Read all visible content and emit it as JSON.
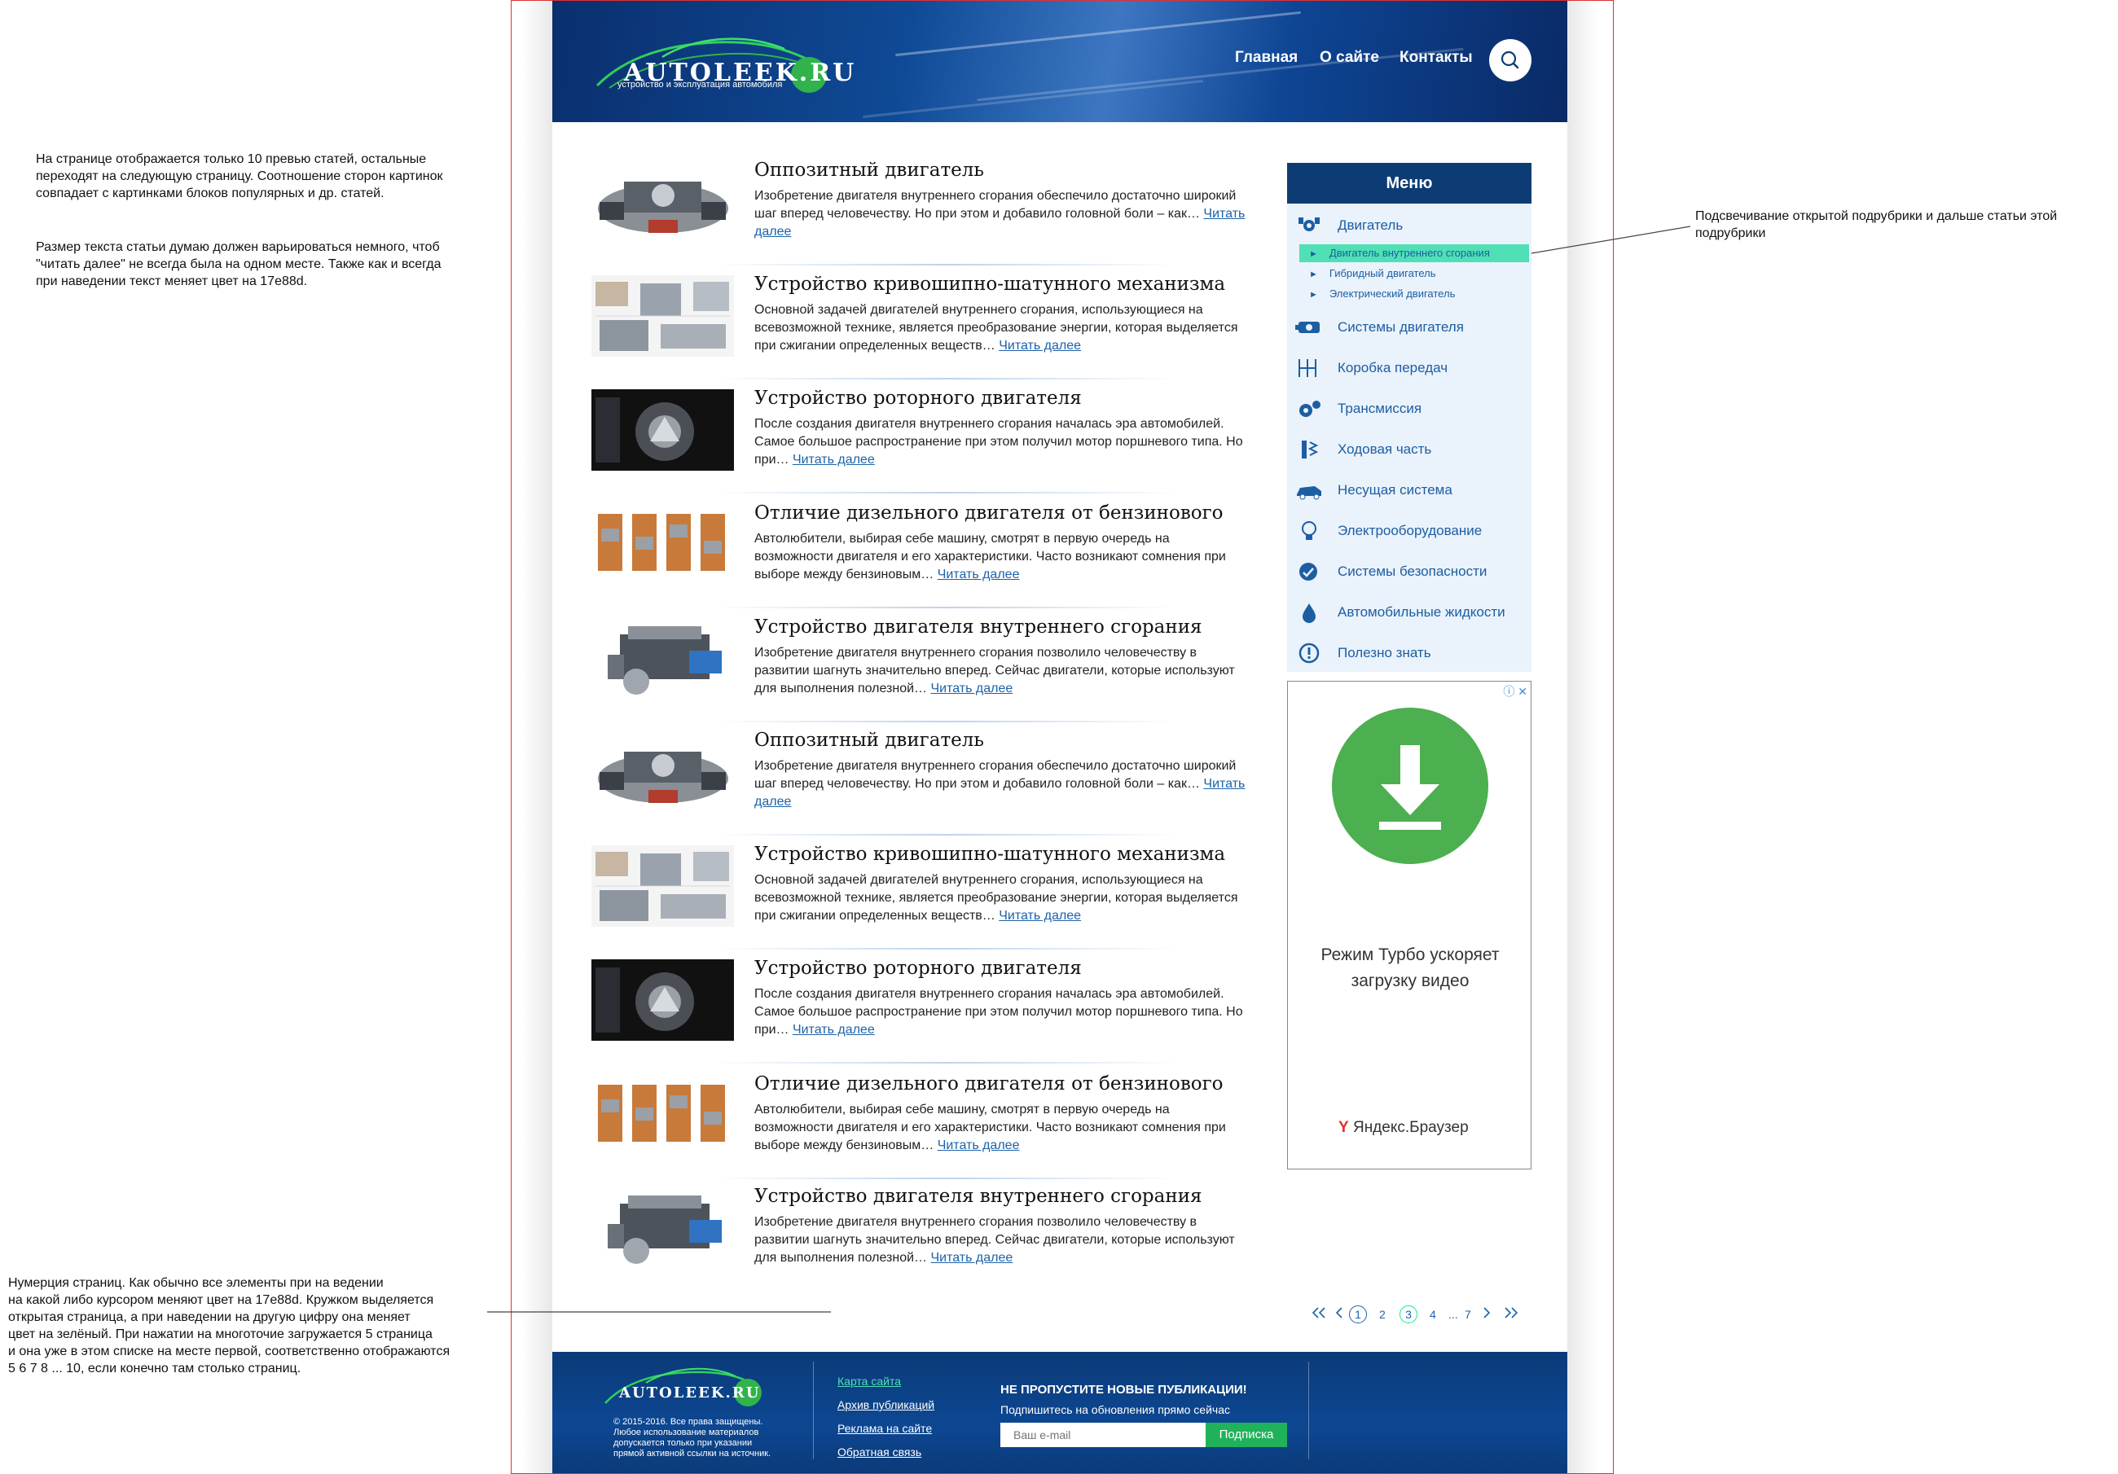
{
  "notes": {
    "note1": [
      "На странице отображается только 10 превью статей, остальные",
      "переходят на следующую страницу. Соотношение сторон картинок",
      "совпадает с картинками блоков популярных и др. статей."
    ],
    "note2": [
      "Размер текста статьи думаю должен варьироваться немного, чтоб",
      "\"читать далее\" не всегда была на одном месте. Также как и всегда",
      "при наведении текст меняет цвет на 17e88d."
    ],
    "note3": [
      "Подсвечивание открытой подрубрики и дальше статьи этой",
      "подрубрики"
    ],
    "note4": [
      "Нумерция страниц. Как обычно все элементы при на ведении",
      "на какой либо курсором меняют цвет на 17e88d. Кружком выделяется",
      "открытая страница, а при наведении на другую цифру она меняет",
      "цвет на зелёный. При нажатии на многоточие загружается 5 страница",
      "и она уже в этом списке на месте первой, соответственно отображаются",
      "5 6 7 8 ... 10, если конечно там столько страниц."
    ]
  },
  "header": {
    "logo": "AUTOLEEK.RU",
    "tagline": "устройство и эксплуатация автомобиля",
    "nav": [
      "Главная",
      "О сайте",
      "Контакты"
    ]
  },
  "articles": [
    {
      "title": "Оппозитный двигатель",
      "text": "Изобретение двигателя внутреннего сгорания обеспечило достаточно широкий шаг вперед человечеству. Но при этом и добавило головной боли – как…",
      "img": "boxer"
    },
    {
      "title": "Устройство кривошипно-шатунного механизма",
      "text": "Основной задачей двигателей внутреннего сгорания, использующиеся на всевозможной технике, является преобразование энергии, которая выделяется при сжигании определенных веществ…",
      "img": "crank"
    },
    {
      "title": "Устройство роторного двигателя",
      "text": "После создания двигателя внутреннего сгорания началась эра автомобилей. Самое большое распространение при этом получил мотор поршневого типа. Но при…",
      "img": "rotary"
    },
    {
      "title": "Отличие дизельного двигателя от бензинового",
      "text": "Автолюбители, выбирая себе машину, смотрят в первую очередь на возможности двигателя и его характеристики. Часто возникают сомнения при выборе между бензиновым…",
      "img": "diesel"
    },
    {
      "title": "Устройство двигателя внутреннего сгорания",
      "text": "Изобретение двигателя внутреннего сгорания позволило человечеству в развитии шагнуть значительно вперед. Сейчас двигатели, которые используют для выполнения полезной…",
      "img": "v8"
    },
    {
      "title": "Оппозитный двигатель",
      "text": "Изобретение двигателя внутреннего сгорания обеспечило достаточно широкий шаг вперед человечеству. Но при этом и добавило головной боли – как…",
      "img": "boxer"
    },
    {
      "title": "Устройство кривошипно-шатунного механизма",
      "text": "Основной задачей двигателей внутреннего сгорания, использующиеся на всевозможной технике, является преобразование энергии, которая выделяется при сжигании определенных веществ…",
      "img": "crank"
    },
    {
      "title": "Устройство роторного двигателя",
      "text": "После создания двигателя внутреннего сгорания началась эра автомобилей. Самое большое распространение при этом получил мотор поршневого типа. Но при…",
      "img": "rotary"
    },
    {
      "title": "Отличие дизельного двигателя от бензинового",
      "text": "Автолюбители, выбирая себе машину, смотрят в первую очередь на возможности двигателя и его характеристики. Часто возникают сомнения при выборе между бензиновым…",
      "img": "diesel"
    },
    {
      "title": "Устройство двигателя внутреннего сгорания",
      "text": "Изобретение двигателя внутреннего сгорания позволило человечеству в развитии шагнуть значительно вперед. Сейчас двигатели, которые используют для выполнения полезной…",
      "img": "v8"
    }
  ],
  "read_more": "Читать далее",
  "menu": {
    "title": "Меню",
    "items": [
      {
        "label": "Двигатель",
        "icon": "engine-icon"
      },
      {
        "label": "Системы двигателя",
        "icon": "engine-system-icon"
      },
      {
        "label": "Коробка передач",
        "icon": "gearbox-icon"
      },
      {
        "label": "Трансмиссия",
        "icon": "transmission-icon"
      },
      {
        "label": "Ходовая часть",
        "icon": "suspension-icon"
      },
      {
        "label": "Несущая система",
        "icon": "car-body-icon"
      },
      {
        "label": "Электрооборудование",
        "icon": "bulb-icon"
      },
      {
        "label": "Системы безопасности",
        "icon": "safety-icon"
      },
      {
        "label": "Автомобильные жидкости",
        "icon": "drop-icon"
      },
      {
        "label": "Полезно знать",
        "icon": "info-icon"
      }
    ],
    "subitems": [
      "Двигатель внутреннего сгорания",
      "Гибридный двигатель",
      "Электрический двигатель"
    ],
    "active_sub": 0
  },
  "ad": {
    "text_line1": "Режим Турбо ускоряет",
    "text_line2": "загрузку видео",
    "brand": "Яндекс.Браузер"
  },
  "pagination": {
    "pages": [
      "1",
      "2",
      "3",
      "4",
      "...",
      "7"
    ],
    "current": "1"
  },
  "footer": {
    "logo": "AUTOLEEK.RU",
    "copyright": [
      "© 2015-2016. Все права защищены.",
      "Любое использование материалов",
      "допускается только при указании",
      "прямой активной ссылки на источник."
    ],
    "links": [
      "Карта сайта",
      "Архив публикаций",
      "Реклама на сайте",
      "Обратная связь"
    ],
    "subscribe_title": "НЕ ПРОПУСТИТЕ НОВЫЕ ПУБЛИКАЦИИ!",
    "subscribe_text": "Подпишитесь на обновления прямо сейчас",
    "email_placeholder": "Ваш e-mail",
    "subscribe_button": "Подписка"
  },
  "colors": {
    "accent_hover": "#17e88d",
    "header_blue": "#0d3c74",
    "link_blue": "#1d62a8",
    "subscribe_green": "#1fb25a"
  }
}
